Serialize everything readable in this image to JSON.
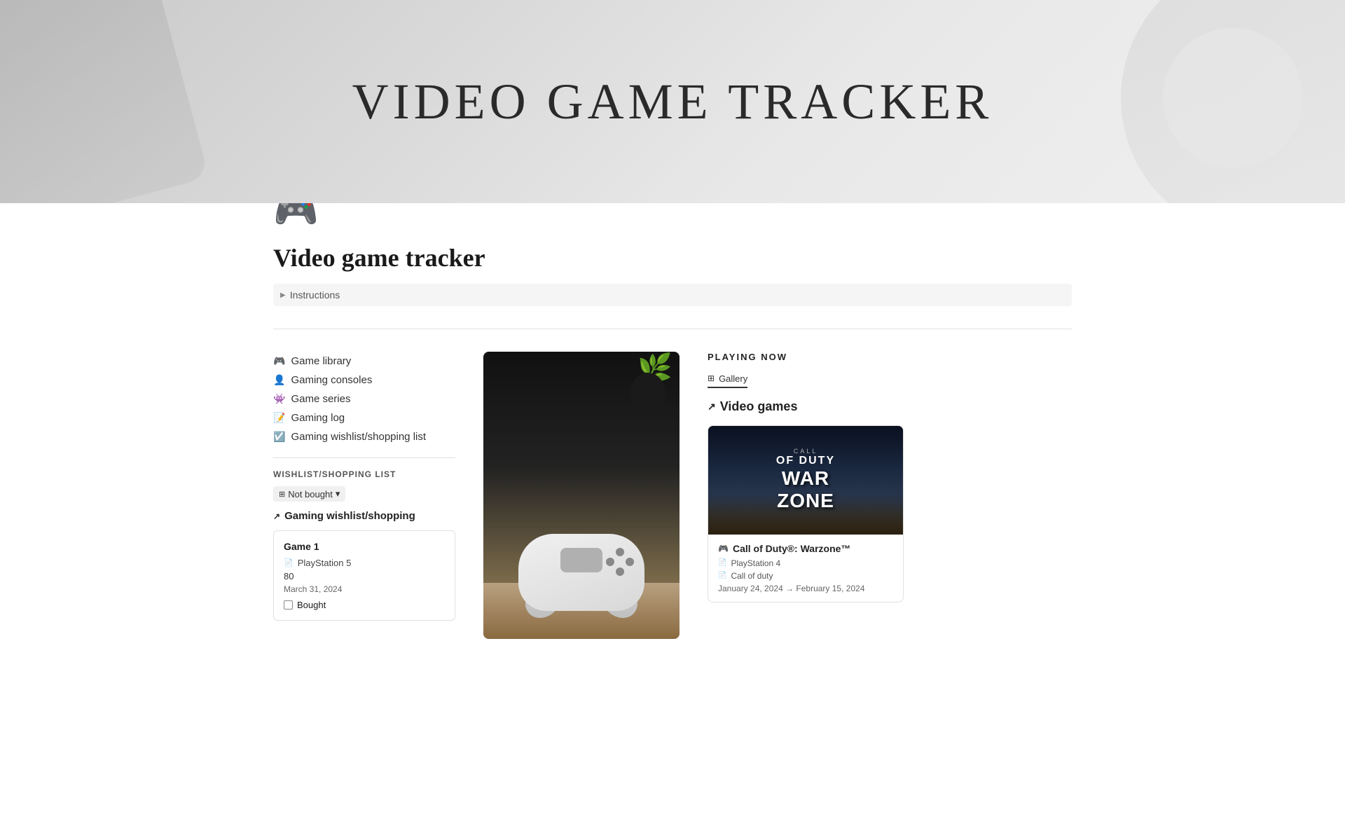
{
  "hero": {
    "title": "VIDEO GAME TRACKER"
  },
  "page": {
    "icon": "🎮",
    "title": "Video game tracker"
  },
  "instructions": {
    "label": "Instructions"
  },
  "nav": {
    "items": [
      {
        "id": "game-library",
        "icon": "🎮",
        "label": "Game library"
      },
      {
        "id": "gaming-consoles",
        "icon": "👤",
        "label": "Gaming consoles"
      },
      {
        "id": "game-series",
        "icon": "👾",
        "label": "Game series"
      },
      {
        "id": "gaming-log",
        "icon": "📝",
        "label": "Gaming log"
      },
      {
        "id": "gaming-wishlist",
        "icon": "☑️",
        "label": "Gaming wishlist/shopping list"
      }
    ]
  },
  "wishlist": {
    "section_title": "WISHLIST/SHOPPING LIST",
    "filter_label": "Not bought",
    "link_label": "Gaming wishlist/shopping",
    "card": {
      "game_name": "Game 1",
      "console": "PlayStation 5",
      "price": "80",
      "date": "March 31, 2024",
      "bought_label": "Bought"
    }
  },
  "playing_now": {
    "section_title": "PLAYING NOW",
    "gallery_tab": "Gallery",
    "video_games_link": "Video games",
    "game_card": {
      "name": "Call of Duty®: Warzone™",
      "console": "PlayStation 4",
      "genre": "Call of duty",
      "dates": "January 24, 2024 → February 15, 2024",
      "cover_line1": "CALL",
      "cover_line2": "OF DUTY",
      "cover_line3": "WAR",
      "cover_line4": "ZONE",
      "cover_sub": "WARZONE"
    }
  }
}
